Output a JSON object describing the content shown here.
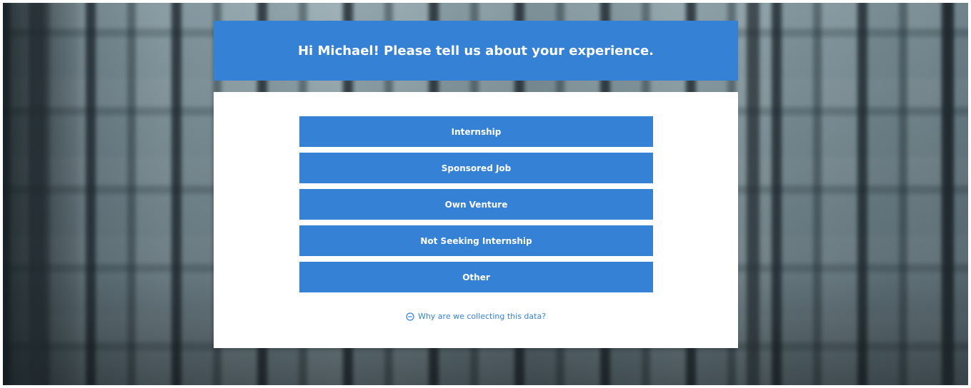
{
  "header": {
    "title": "Hi Michael! Please tell us about your experience."
  },
  "options": [
    {
      "label": "Internship"
    },
    {
      "label": "Sponsored Job"
    },
    {
      "label": "Own Venture"
    },
    {
      "label": "Not Seeking Internship"
    },
    {
      "label": "Other"
    }
  ],
  "info_link": {
    "icon": "minus-circle-icon",
    "label": "Why are we collecting this data?"
  },
  "colors": {
    "accent": "#3581d6",
    "card": "#ffffff",
    "button_text": "#ffffff"
  }
}
